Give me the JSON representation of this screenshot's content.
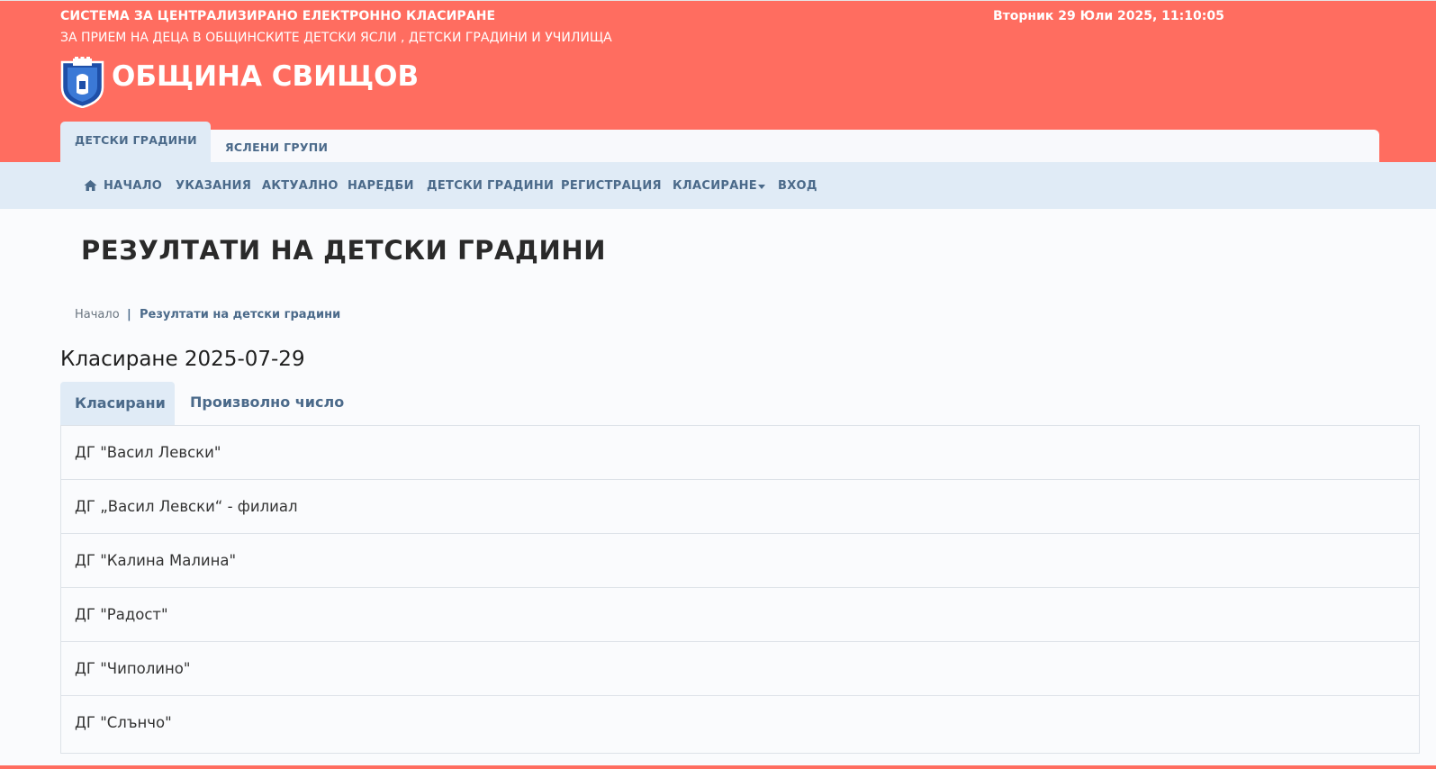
{
  "header": {
    "system_title": "СИСТЕМА ЗА ЦЕНТРАЛИЗИРАНО ЕЛЕКТРОННО КЛАСИРАНЕ",
    "system_subtitle": "ЗА ПРИЕМ НА ДЕЦА В ОБЩИНСКИТЕ ДЕТСКИ ЯСЛИ , ДЕТСКИ ГРАДИНИ И УЧИЛИЩА",
    "datetime": "Вторник 29 Юли 2025, 11:10:05",
    "municipality": "ОБЩИНА СВИЩОВ",
    "crest_icon": "municipal-crest-icon"
  },
  "type_tabs": [
    {
      "label": "ДЕТСКИ ГРАДИНИ",
      "active": true
    },
    {
      "label": "ЯСЛЕНИ ГРУПИ",
      "active": false
    }
  ],
  "nav": {
    "home_icon": "home-icon",
    "items": [
      "НАЧАЛО",
      "УКАЗАНИЯ",
      "АКТУАЛНО",
      "НАРЕДБИ",
      "ДЕТСКИ ГРАДИНИ",
      "РЕГИСТРАЦИЯ",
      "КЛАСИРАНЕ",
      "ВХОД"
    ]
  },
  "page": {
    "title": "РЕЗУЛТАТИ НА ДЕТСКИ ГРАДИНИ",
    "breadcrumb": {
      "home": "Начало",
      "separator": "|",
      "current": "Резултати на детски градини"
    },
    "ranking_title": "Класиране 2025-07-29",
    "tabs": [
      {
        "label": "Класирани",
        "active": true
      },
      {
        "label": "Произволно число",
        "active": false
      }
    ],
    "kindergartens": [
      "ДГ \"Васил Левски\"",
      "ДГ „Васил Левски“ - филиал",
      "ДГ \"Калина Малина\"",
      "ДГ \"Радост\"",
      "ДГ \"Чиполино\"",
      "ДГ \"Слънчо\""
    ]
  },
  "colors": {
    "header_bg": "#ff6d60",
    "nav_bg": "#e0ebf6",
    "accent_text": "#4b6a8a"
  }
}
